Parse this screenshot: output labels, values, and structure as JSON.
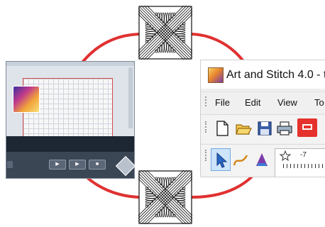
{
  "colors": {
    "arrow": "#e03131",
    "machine_bar": "#1d2733",
    "hoop_border": "#d44a4a",
    "app_machine_button": "#e5322d"
  },
  "machine": {
    "title": "",
    "controls": [
      {
        "icon": "play-icon",
        "glyph": "▶"
      },
      {
        "icon": "play-icon",
        "glyph": "▶"
      },
      {
        "icon": "stop-icon",
        "glyph": "■"
      }
    ]
  },
  "app": {
    "title": "Art and Stitch 4.0 - t",
    "menu": [
      "File",
      "Edit",
      "View",
      "To"
    ],
    "toolbar_icons": [
      "new-file-icon",
      "open-folder-icon",
      "save-icon",
      "print-icon",
      "send-to-machine-icon"
    ],
    "ruler_label": "-7",
    "tools": [
      "select-arrow-icon",
      "curve-tool-icon",
      "text-tool-icon",
      "star-tool-icon"
    ]
  },
  "patterns": [
    "stitch-pattern-top",
    "stitch-pattern-bottom"
  ]
}
